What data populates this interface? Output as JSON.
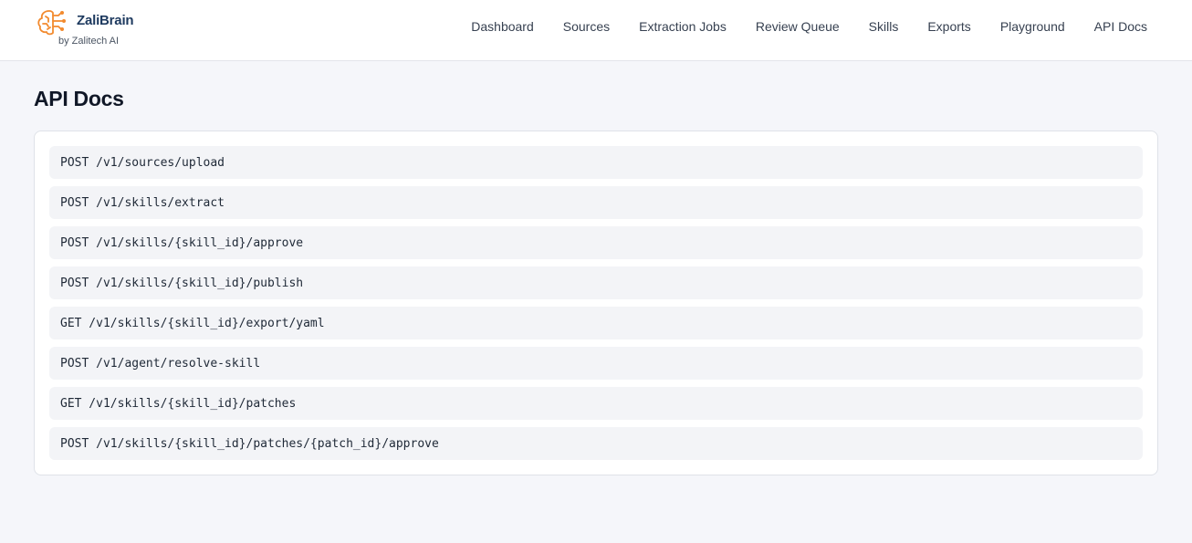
{
  "brand": {
    "name": "ZaliBrain",
    "subtitle": "by Zalitech AI",
    "logo_icon": "brain-circuit-icon",
    "accent_color": "#f28a2e"
  },
  "nav": {
    "items": [
      {
        "label": "Dashboard"
      },
      {
        "label": "Sources"
      },
      {
        "label": "Extraction Jobs"
      },
      {
        "label": "Review Queue"
      },
      {
        "label": "Skills"
      },
      {
        "label": "Exports"
      },
      {
        "label": "Playground"
      },
      {
        "label": "API Docs"
      }
    ]
  },
  "page": {
    "title": "API Docs"
  },
  "endpoints": [
    {
      "text": "POST /v1/sources/upload"
    },
    {
      "text": "POST /v1/skills/extract"
    },
    {
      "text": "POST /v1/skills/{skill_id}/approve"
    },
    {
      "text": "POST /v1/skills/{skill_id}/publish"
    },
    {
      "text": "GET /v1/skills/{skill_id}/export/yaml"
    },
    {
      "text": "POST /v1/agent/resolve-skill"
    },
    {
      "text": "GET /v1/skills/{skill_id}/patches"
    },
    {
      "text": "POST /v1/skills/{skill_id}/patches/{patch_id}/approve"
    }
  ]
}
